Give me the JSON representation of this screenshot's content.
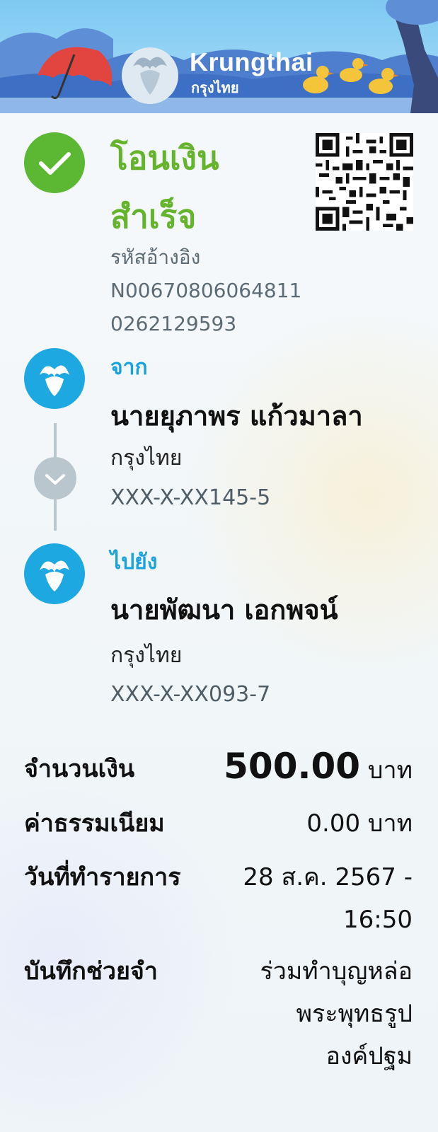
{
  "brand": {
    "name": "Krungthai",
    "sub": "กรุงไทย"
  },
  "status": {
    "title_line1": "โอนเงิน",
    "title_line2": "สำเร็จ"
  },
  "reference": {
    "label": "รหัสอ้างอิง",
    "line1": "N00670806064811",
    "line2": "0262129593"
  },
  "from": {
    "label": "จาก",
    "name": "นายยุภาพร แก้วมาลา",
    "bank": "กรุงไทย",
    "account": "XXX-X-XX145-5"
  },
  "to": {
    "label": "ไปยัง",
    "name": "นายพัฒนา เอกพจน์",
    "bank": "กรุงไทย",
    "account": "XXX-X-XX093-7"
  },
  "details": {
    "amount_label": "จำนวนเงิน",
    "amount_value": "500.00",
    "amount_currency": "บาท",
    "fee_label": "ค่าธรรมเนียม",
    "fee_value": "0.00 บาท",
    "date_label": "วันที่ทำรายการ",
    "date_line1": "28 ส.ค. 2567 -",
    "date_line2": "16:50",
    "memo_label": "บันทึกช่วยจำ",
    "memo_line1": "ร่วมทำบุญหล่อ",
    "memo_line2": "พระพุทธรูป",
    "memo_line3": "องค์ปฐม"
  },
  "colors": {
    "success": "#5cb833",
    "brand_blue": "#1ea8e1",
    "title_green": "#66b32e"
  },
  "icons": [
    "umbrella-icon",
    "krungthai-logo",
    "duck-icon",
    "check-icon",
    "qr-code",
    "chevron-down-icon"
  ]
}
